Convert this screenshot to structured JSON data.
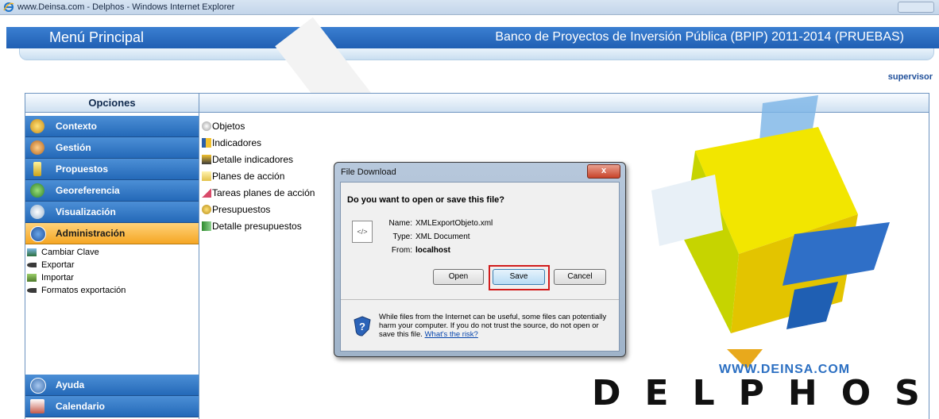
{
  "window": {
    "title": "www.Deinsa.com - Delphos - Windows Internet Explorer"
  },
  "header": {
    "menu_title": "Menú Principal",
    "app_title": "Banco de Proyectos de Inversión Pública (BPIP) 2011-2014 (PRUEBAS)",
    "user": "supervisor"
  },
  "sidebar": {
    "heading": "Opciones",
    "items": [
      {
        "label": "Contexto",
        "icon": "tools-icon"
      },
      {
        "label": "Gestión",
        "icon": "people-icon"
      },
      {
        "label": "Propuestos",
        "icon": "document-icon"
      },
      {
        "label": "Georeferencia",
        "icon": "globe-icon"
      },
      {
        "label": "Visualización",
        "icon": "magnifier-icon"
      },
      {
        "label": "Administración",
        "icon": "lock-icon",
        "active": true
      },
      {
        "label": "Ayuda",
        "icon": "help-icon"
      },
      {
        "label": "Calendario",
        "icon": "calendar-icon"
      }
    ],
    "subitems": [
      {
        "label": "Cambiar Clave"
      },
      {
        "label": "Exportar"
      },
      {
        "label": "Importar"
      },
      {
        "label": "Formatos exportación"
      }
    ]
  },
  "content": {
    "items": [
      {
        "label": "Objetos"
      },
      {
        "label": "Indicadores"
      },
      {
        "label": "Detalle indicadores"
      },
      {
        "label": "Planes de acción"
      },
      {
        "label": "Tareas planes de acción"
      },
      {
        "label": "Presupuestos"
      },
      {
        "label": "Detalle presupuestos"
      }
    ]
  },
  "logo": {
    "url_text": "WWW.DEINSA.COM",
    "brand": "DELPHOS"
  },
  "dialog": {
    "title": "File Download",
    "question": "Do you want to open or save this file?",
    "name_label": "Name:",
    "name_value": "XMLExportObjeto.xml",
    "type_label": "Type:",
    "type_value": "XML Document",
    "from_label": "From:",
    "from_value": "localhost",
    "open_label": "Open",
    "save_label": "Save",
    "cancel_label": "Cancel",
    "close_label": "x",
    "warning": "While files from the Internet can be useful, some files can potentially harm your computer. If you do not trust the source, do not open or save this file.",
    "risk_link": "What's the risk?"
  },
  "colors": {
    "banner": "#2469b8",
    "active_menu": "#f5a623",
    "highlight": "#d11c1c"
  }
}
